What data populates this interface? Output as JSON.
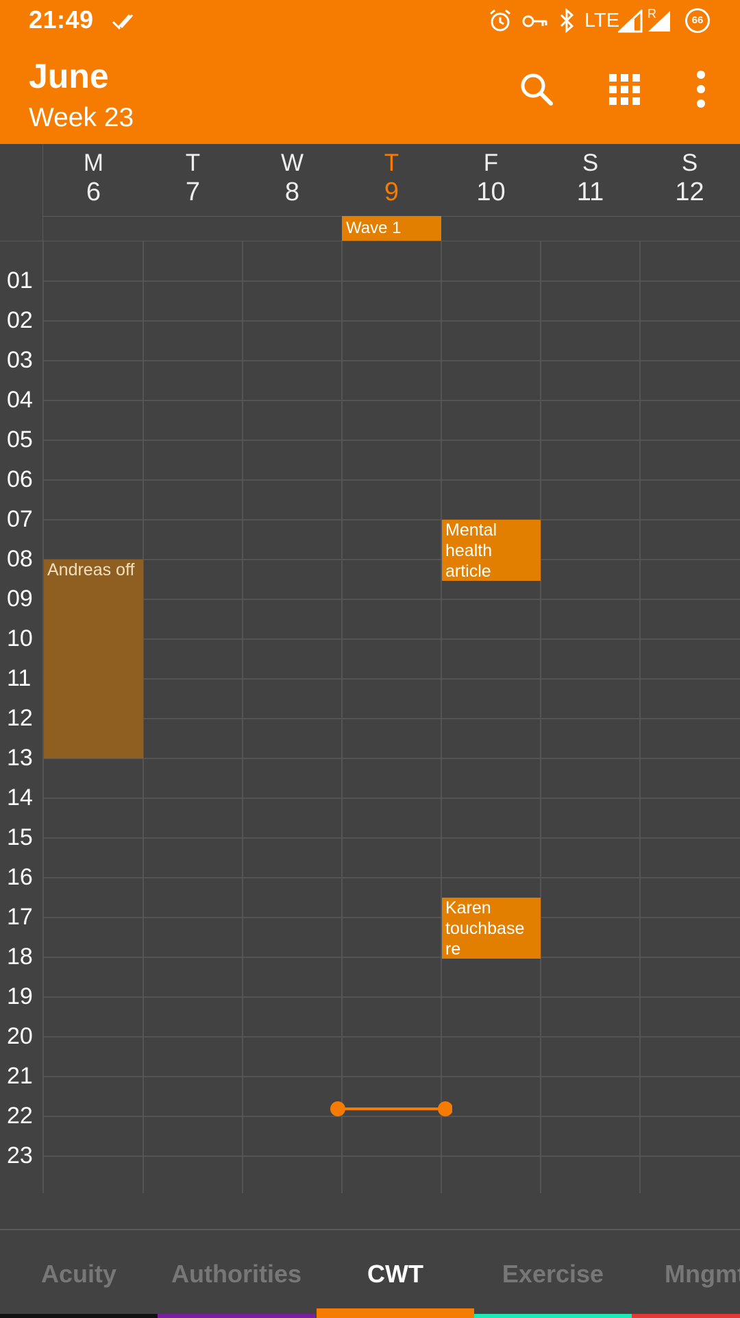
{
  "status_bar": {
    "time": "21:49",
    "network": "LTE",
    "roaming": "R",
    "battery": "66"
  },
  "app_bar": {
    "title": "June",
    "subtitle": "Week 23",
    "search_icon": "search-icon",
    "grid_icon": "apps-grid-icon",
    "menu_icon": "more-vert-icon"
  },
  "days": [
    {
      "letter": "M",
      "num": "6"
    },
    {
      "letter": "T",
      "num": "7"
    },
    {
      "letter": "W",
      "num": "8"
    },
    {
      "letter": "T",
      "num": "9",
      "today": true
    },
    {
      "letter": "F",
      "num": "10"
    },
    {
      "letter": "S",
      "num": "11"
    },
    {
      "letter": "S",
      "num": "12"
    }
  ],
  "all_day_events": [
    {
      "title": "Wave 1",
      "day": "T 9",
      "color": "#e27f00"
    }
  ],
  "hours": [
    "01",
    "02",
    "03",
    "04",
    "05",
    "06",
    "07",
    "08",
    "09",
    "10",
    "11",
    "12",
    "13",
    "14",
    "15",
    "16",
    "17",
    "18",
    "19",
    "20",
    "21",
    "22",
    "23"
  ],
  "events": [
    {
      "title": "Andreas off",
      "day": "M 6",
      "start": "08:00",
      "end": "13:00",
      "color": "#8f5f22"
    },
    {
      "title": "Mental health article",
      "day": "F 10",
      "start": "07:00",
      "end": "08:30",
      "color": "#e27f00"
    },
    {
      "title": "Karen touchbase re SteerCo…",
      "day": "F 10",
      "start": "17:00",
      "end": "18:30",
      "color": "#e27f00"
    }
  ],
  "tabs": [
    {
      "label": "Acuity",
      "color": "#111111"
    },
    {
      "label": "Authorities",
      "color": "#7b1fa2"
    },
    {
      "label": "CWT",
      "color": "#f57c00",
      "active": true
    },
    {
      "label": "Exercise",
      "color": "#1de9b6"
    },
    {
      "label": "Mngmt",
      "color": "#e53935"
    }
  ],
  "colors": {
    "accent": "#f57c00",
    "background": "#424242",
    "grid_line": "#5a5a5a"
  }
}
